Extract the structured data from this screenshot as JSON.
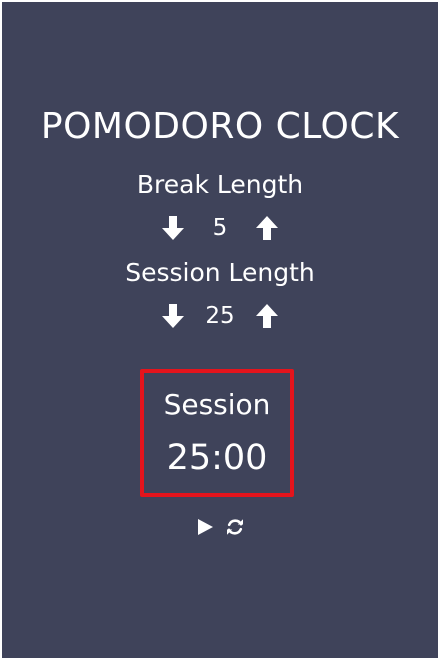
{
  "app": {
    "title": "POMODORO CLOCK",
    "background_color": "#3f435a",
    "accent_color": "#e4141c"
  },
  "break": {
    "label": "Break Length",
    "value": "5",
    "decrement_icon": "arrow-down-icon",
    "increment_icon": "arrow-up-icon"
  },
  "session": {
    "label": "Session Length",
    "value": "25",
    "decrement_icon": "arrow-down-icon",
    "increment_icon": "arrow-up-icon"
  },
  "timer": {
    "label": "Session",
    "time": "25:00"
  },
  "controls": {
    "play_icon": "play-icon",
    "reset_icon": "refresh-icon"
  }
}
